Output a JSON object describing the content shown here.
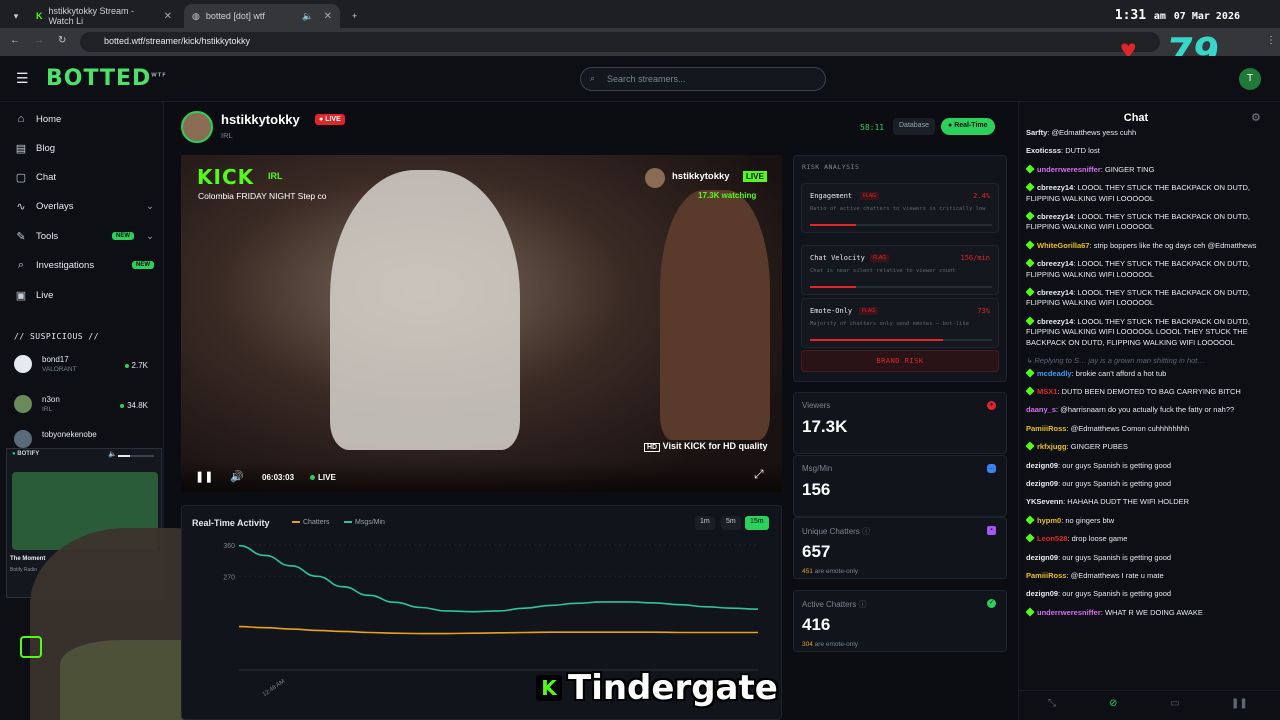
{
  "browser": {
    "tabs": [
      {
        "title": "hstikkytokky Stream - Watch Li"
      },
      {
        "title": "botted [dot] wtf"
      }
    ],
    "url": "botted.wtf/streamer/kick/hstikkytokky"
  },
  "clock": {
    "time": "1:31",
    "ampm": "am",
    "date": "07 Mar 2026"
  },
  "overlay": {
    "heart_count": "79",
    "caption": "Tindergate",
    "caption_icon": "K"
  },
  "app": {
    "logo": "BOTTED",
    "logo_sup": "WTF",
    "search_placeholder": "Search streamers...",
    "user_initial": "T"
  },
  "sidebar": {
    "nav": [
      {
        "label": "Home",
        "icon": "home-icon"
      },
      {
        "label": "Blog",
        "icon": "blog-icon"
      },
      {
        "label": "Chat",
        "icon": "chat-icon"
      },
      {
        "label": "Overlays",
        "icon": "overlays-icon"
      },
      {
        "label": "Tools",
        "icon": "tools-icon",
        "badge": "NEW"
      },
      {
        "label": "Investigations",
        "icon": "search-icon",
        "badge": "NEW"
      },
      {
        "label": "Live",
        "icon": "tv-icon"
      }
    ],
    "suspicious_title": "// SUSPICIOUS //",
    "suspicious": [
      {
        "name": "bond17",
        "game": "VALORANT",
        "count": "2.7K"
      },
      {
        "name": "n3on",
        "game": "IRL",
        "count": "34.8K"
      },
      {
        "name": "tobyonekenobe",
        "game": "",
        "count": ""
      }
    ]
  },
  "botify": {
    "title": "BOTIFY",
    "song": "The Moment",
    "artist": "Botify Radio"
  },
  "stream": {
    "name": "hstikkytokky",
    "live_label": "LIVE",
    "category": "IRL",
    "timer": "58:11",
    "db_button": "Database",
    "realtime_button": "Real-Time"
  },
  "video": {
    "brand": "KICK",
    "category": "IRL",
    "title": "Colombia FRIDAY NIGHT Step co",
    "channel": "hstikkytokky",
    "live": "LIVE",
    "watching": "17.3K watching",
    "hd_prompt": "Visit KICK for HD quality",
    "time": "06:03:03",
    "live_indicator": "LIVE"
  },
  "risk": {
    "title": "RISK ANALYSIS",
    "items": [
      {
        "label": "Engagement",
        "flag": "FLAG",
        "value": "2.4%",
        "desc": "Ratio of active chatters to viewers is critically low",
        "level": 0.25
      },
      {
        "label": "Chat Velocity",
        "flag": "FLAG",
        "value": "156/min",
        "desc": "Chat is near silent relative to viewer count",
        "level": 0.25
      },
      {
        "label": "Emote-Only",
        "flag": "FLAG",
        "value": "73%",
        "desc": "Majority of chatters only send emotes — bot-like",
        "level": 0.73
      }
    ],
    "brand_risk": "BRAND RISK"
  },
  "stats": [
    {
      "label": "Viewers",
      "value": "17.3K",
      "sub_num": "",
      "sub_text": "",
      "icon": "eye-icon",
      "color": "#e0262b"
    },
    {
      "label": "Msg/Min",
      "value": "156",
      "sub_num": "",
      "sub_text": "",
      "icon": "message-icon",
      "color": "#3b82f6"
    },
    {
      "label": "Unique Chatters",
      "value": "657",
      "sub_num": "451",
      "sub_text": "are emote-only",
      "icon": "users-icon",
      "color": "#a855f7"
    },
    {
      "label": "Active Chatters",
      "value": "416",
      "sub_num": "304",
      "sub_text": "are emote-only",
      "icon": "check-icon",
      "color": "#2bd15b"
    }
  ],
  "activity": {
    "title": "Real-Time Activity",
    "legend": [
      "Chatters",
      "Msgs/Min"
    ],
    "ranges": [
      "1m",
      "5m",
      "15m"
    ],
    "active_range": "15m"
  },
  "chart_data": {
    "type": "line",
    "title": "Real-Time Activity",
    "x": [
      "",
      "12:48 AM",
      "",
      "",
      "",
      "",
      "",
      "",
      "",
      "",
      "",
      "",
      "",
      "",
      "",
      "",
      "",
      "",
      "",
      "",
      ""
    ],
    "y_ticks": [
      "360",
      "270"
    ],
    "ylim": [
      0,
      360
    ],
    "series": [
      {
        "name": "Msgs/Min",
        "color": "#2fc59a",
        "values": [
          358,
          330,
          300,
          270,
          240,
          215,
          195,
          180,
          170,
          168,
          170,
          178,
          186,
          192,
          196,
          196,
          193,
          188,
          182,
          178,
          175
        ]
      },
      {
        "name": "Chatters",
        "color": "#e8a020",
        "values": [
          125,
          122,
          118,
          114,
          111,
          108,
          106,
          105,
          105,
          106,
          107,
          108,
          109,
          109,
          109,
          109,
          109,
          108,
          108,
          108,
          108
        ]
      }
    ]
  },
  "chat": {
    "title": "Chat",
    "messages": [
      {
        "user": "Sarfty",
        "color": "#e6e9ef",
        "badge": false,
        "text": "@Edmatthews yess cuhh"
      },
      {
        "user": "Exoticsss",
        "color": "#e6e9ef",
        "badge": false,
        "text": "DUTD lost"
      },
      {
        "user": "underrweresniffer",
        "color": "#d66ef2",
        "badge": true,
        "text": "GINGER TING"
      },
      {
        "user": "cbreezy14",
        "color": "#e6e9ef",
        "badge": true,
        "text": "LOOOL THEY STUCK THE BACKPACK ON DUTD, FLIPPING WALKING WIFI LOOOOOL"
      },
      {
        "user": "cbreezy14",
        "color": "#e6e9ef",
        "badge": true,
        "text": "LOOOL THEY STUCK THE BACKPACK ON DUTD, FLIPPING WALKING WIFI LOOOOOL"
      },
      {
        "user": "WhiteGorilla67",
        "color": "#e8c020",
        "badge": true,
        "text": "strip boppers like the og days ceh @Edmatthews"
      },
      {
        "user": "cbreezy14",
        "color": "#e6e9ef",
        "badge": true,
        "text": "LOOOL THEY STUCK THE BACKPACK ON DUTD, FLIPPING WALKING WIFI LOOOOOL"
      },
      {
        "user": "cbreezy14",
        "color": "#e6e9ef",
        "badge": true,
        "text": "LOOOL THEY STUCK THE BACKPACK ON DUTD, FLIPPING WALKING WIFI LOOOOOL"
      },
      {
        "user": "cbreezy14",
        "color": "#e6e9ef",
        "badge": true,
        "text": "LOOOL THEY STUCK THE BACKPACK ON DUTD, FLIPPING WALKING WIFI LOOOOOL LOOOL THEY STUCK THE BACKPACK ON DUTD, FLIPPING WALKING WIFI LOOOOOL"
      },
      {
        "reply": "↳ Replying to S… jay is a grown man shitting in hot…"
      },
      {
        "user": "mcdeadly",
        "color": "#3b9af2",
        "badge": true,
        "text": "brokie can't afford a hot tub"
      },
      {
        "user": "MSX1",
        "color": "#e0262b",
        "badge": true,
        "text": "DUTD BEEN DEMOTED TO BAG CARRYING BITCH"
      },
      {
        "user": "daany_s",
        "color": "#d66ef2",
        "badge": false,
        "text": "@harrisnaarn do you actually fuck the fatty or nah??"
      },
      {
        "user": "PamiiiRoss",
        "color": "#e8c020",
        "badge": false,
        "text": "@Edmatthews Comon cuhhhhhhhh"
      },
      {
        "user": "rkfxjugg",
        "color": "#e8c020",
        "badge": true,
        "text": "GINGER PUBES"
      },
      {
        "user": "dezign09",
        "color": "#e6e9ef",
        "badge": false,
        "text": "our guys Spanish is getting good"
      },
      {
        "user": "dezign09",
        "color": "#e6e9ef",
        "badge": false,
        "text": "our guys Spanish is getting good"
      },
      {
        "user": "YKSevenn",
        "color": "#e6e9ef",
        "badge": false,
        "text": "HAHAHA DUDT THE WIFI HOLDER"
      },
      {
        "user": "hypm0",
        "color": "#e8c020",
        "badge": true,
        "text": "no gingers btw"
      },
      {
        "user": "Leon528",
        "color": "#e0262b",
        "badge": true,
        "text": "drop loose game"
      },
      {
        "user": "dezign09",
        "color": "#e6e9ef",
        "badge": false,
        "text": "our guys Spanish is getting good"
      },
      {
        "user": "PamiiiRoss",
        "color": "#e8c020",
        "badge": false,
        "text": "@Edmatthews I rate u mate"
      },
      {
        "user": "dezign09",
        "color": "#e6e9ef",
        "badge": false,
        "text": "our guys Spanish is getting good"
      },
      {
        "user": "underrweresniffer",
        "color": "#d66ef2",
        "badge": true,
        "text": "WHAT R WE DOING AWAKE"
      }
    ]
  }
}
